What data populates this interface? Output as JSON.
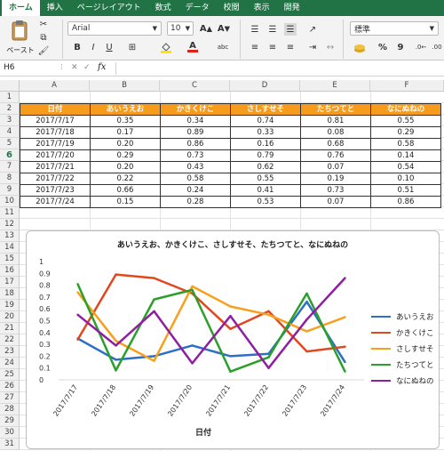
{
  "ribbon_tabs": [
    "ホーム",
    "挿入",
    "ページレイアウト",
    "数式",
    "データ",
    "校閲",
    "表示",
    "開発"
  ],
  "active_tab": 0,
  "clipboard": {
    "paste_label": "ペースト"
  },
  "font": {
    "name": "Arial",
    "size": "10"
  },
  "number_format": "標準",
  "formula_bar": {
    "cell_ref": "H6",
    "fx": "fx",
    "content": ""
  },
  "columns": [
    "A",
    "B",
    "C",
    "D",
    "E",
    "F"
  ],
  "rows": [
    "1",
    "2",
    "3",
    "4",
    "5",
    "6",
    "7",
    "8",
    "9",
    "10",
    "11",
    "12",
    "13",
    "14",
    "15",
    "16",
    "17",
    "18",
    "19",
    "20",
    "21",
    "22",
    "23",
    "24",
    "25",
    "26",
    "27",
    "28",
    "29",
    "30",
    "31"
  ],
  "selected_row": "6",
  "table": {
    "headers": [
      "日付",
      "あいうえお",
      "かきくけこ",
      "さしすせそ",
      "たちつてと",
      "なにぬねの"
    ],
    "rows": [
      [
        "2017/7/17",
        "0.35",
        "0.34",
        "0.74",
        "0.81",
        "0.55"
      ],
      [
        "2017/7/18",
        "0.17",
        "0.89",
        "0.33",
        "0.08",
        "0.29"
      ],
      [
        "2017/7/19",
        "0.20",
        "0.86",
        "0.16",
        "0.68",
        "0.58"
      ],
      [
        "2017/7/20",
        "0.29",
        "0.73",
        "0.79",
        "0.76",
        "0.14"
      ],
      [
        "2017/7/21",
        "0.20",
        "0.43",
        "0.62",
        "0.07",
        "0.54"
      ],
      [
        "2017/7/22",
        "0.22",
        "0.58",
        "0.55",
        "0.19",
        "0.10"
      ],
      [
        "2017/7/23",
        "0.66",
        "0.24",
        "0.41",
        "0.73",
        "0.51"
      ],
      [
        "2017/7/24",
        "0.15",
        "0.28",
        "0.53",
        "0.07",
        "0.86"
      ]
    ]
  },
  "chart_data": {
    "type": "line",
    "title": "あいうえお、かきくけこ、さしすせそ、たちつてと、なにぬねの",
    "xlabel": "日付",
    "ylabel": "",
    "categories": [
      "2017/7/17",
      "2017/7/18",
      "2017/7/19",
      "2017/7/20",
      "2017/7/21",
      "2017/7/22",
      "2017/7/23",
      "2017/7/24"
    ],
    "ylim": [
      0,
      1
    ],
    "yticks": [
      "0",
      "0.1",
      "0.2",
      "0.3",
      "0.4",
      "0.5",
      "0.6",
      "0.7",
      "0.8",
      "0.9",
      "1"
    ],
    "legend_position": "right",
    "grid": false,
    "series": [
      {
        "name": "あいうえお",
        "color": "#2e6fc6",
        "values": [
          0.35,
          0.17,
          0.2,
          0.29,
          0.2,
          0.22,
          0.66,
          0.15
        ]
      },
      {
        "name": "かきくけこ",
        "color": "#e2481f",
        "values": [
          0.34,
          0.89,
          0.86,
          0.73,
          0.43,
          0.58,
          0.24,
          0.28
        ]
      },
      {
        "name": "さしすせそ",
        "color": "#f8a01c",
        "values": [
          0.74,
          0.33,
          0.16,
          0.79,
          0.62,
          0.55,
          0.41,
          0.53
        ]
      },
      {
        "name": "たちつてと",
        "color": "#2aa02a",
        "values": [
          0.81,
          0.08,
          0.68,
          0.76,
          0.07,
          0.19,
          0.73,
          0.07
        ]
      },
      {
        "name": "なにぬねの",
        "color": "#8e1fa0",
        "values": [
          0.55,
          0.29,
          0.58,
          0.14,
          0.54,
          0.1,
          0.51,
          0.86
        ]
      }
    ]
  }
}
